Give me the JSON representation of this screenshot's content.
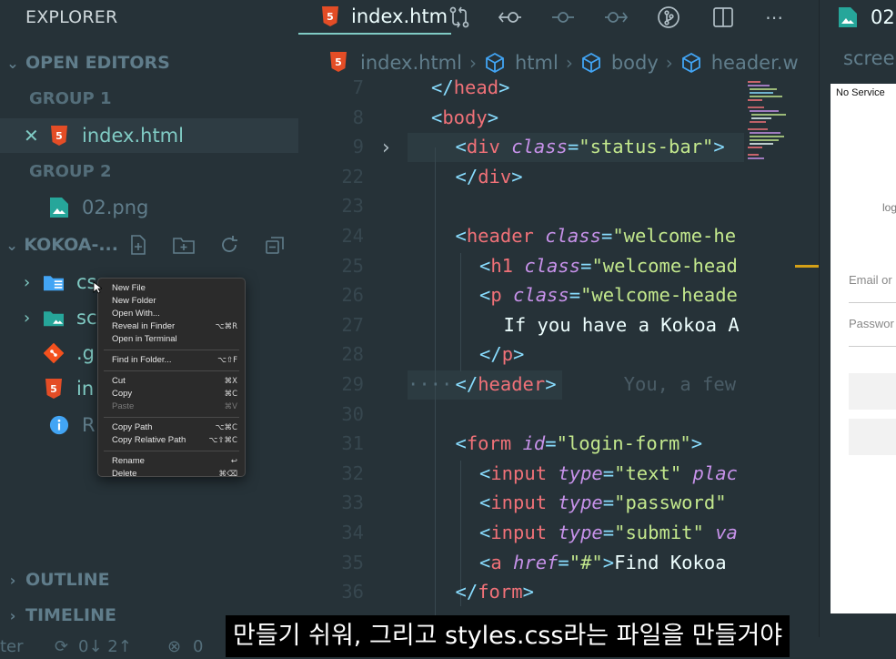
{
  "explorer": {
    "title": "EXPLORER",
    "open_editors_label": "OPEN EDITORS",
    "group1_label": "GROUP 1",
    "group1_file": "index.html",
    "group2_label": "GROUP 2",
    "group2_file": "02.png",
    "project_label": "KOKOA-...",
    "tree_items": [
      "css",
      "sc",
      ".g",
      "in",
      "R"
    ],
    "outline_label": "OUTLINE",
    "timeline_label": "TIMELINE"
  },
  "context_menu": {
    "items": [
      {
        "label": "New File",
        "shortcut": ""
      },
      {
        "label": "New Folder",
        "shortcut": ""
      },
      {
        "label": "Open With...",
        "shortcut": ""
      },
      {
        "label": "Reveal in Finder",
        "shortcut": "⌥⌘R"
      },
      {
        "label": "Open in Terminal",
        "shortcut": ""
      },
      {
        "label": "Find in Folder...",
        "shortcut": "⌥⇧F"
      },
      {
        "label": "Cut",
        "shortcut": "⌘X"
      },
      {
        "label": "Copy",
        "shortcut": "⌘C"
      },
      {
        "label": "Paste",
        "shortcut": "⌘V"
      },
      {
        "label": "Copy Path",
        "shortcut": "⌥⌘C"
      },
      {
        "label": "Copy Relative Path",
        "shortcut": "⌥⇧⌘C"
      },
      {
        "label": "Rename",
        "shortcut": "↩"
      },
      {
        "label": "Delete",
        "shortcut": "⌘⌫"
      }
    ]
  },
  "editor": {
    "tab_label": "index.htm",
    "breadcrumb": [
      "index.html",
      "html",
      "body",
      "header.w"
    ],
    "line_numbers": [
      "7",
      "8",
      "9",
      "22",
      "23",
      "24",
      "25",
      "26",
      "27",
      "28",
      "29",
      "30",
      "31",
      "32",
      "33",
      "34",
      "35",
      "36"
    ],
    "lines": {
      "l7_tag": "head",
      "l8_tag": "body",
      "l9_tag": "div",
      "l9_attr": "class",
      "l9_val": "\"status-bar\"",
      "l22_tag": "div",
      "l24_tag": "header",
      "l24_attr": "class",
      "l24_val": "\"welcome-he",
      "l25_tag": "h1",
      "l25_attr": "class",
      "l25_val": "\"welcome-head",
      "l26_tag": "p",
      "l26_attr": "class",
      "l26_val": "\"welcome-heade",
      "l27_text": "If you have a Kokoa A",
      "l28_tag": "p",
      "l29_tag": "header",
      "l29_ghost": "You, a few",
      "l31_tag": "form",
      "l31_attr": "id",
      "l31_val": "\"login-form\"",
      "l32_tag": "input",
      "l32_attr": "type",
      "l32_val": "\"text\"",
      "l32_rest": "plac",
      "l33_tag": "input",
      "l33_attr": "type",
      "l33_val": "\"password\"",
      "l34_tag": "input",
      "l34_attr": "type",
      "l34_val": "\"submit\"",
      "l34_rest": "va",
      "l35_tag": "a",
      "l35_attr": "href",
      "l35_val": "\"#\"",
      "l35_text": "Find Kokoa",
      "l36_tag": "form"
    }
  },
  "preview": {
    "tab_label": "02",
    "breadcrumb": "scree",
    "status_text": "No Service",
    "log_text": "log",
    "email_placeholder": "Email or",
    "password_placeholder": "Passwor"
  },
  "statusbar": {
    "left_fragment": "ter",
    "sync_text": "0↓ 2↑",
    "errors_text": "0"
  },
  "subtitle": "만들기 쉬워, 그리고 styles.css라는 파일을 만들거야",
  "colors": {
    "background": "#263238",
    "accent": "#80cbc4",
    "tag": "#f07178",
    "attr": "#c792ea",
    "string": "#c3e88d",
    "punct": "#89ddff"
  }
}
